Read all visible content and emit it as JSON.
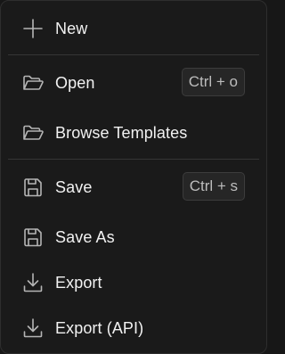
{
  "menu": {
    "items": [
      {
        "label": "New",
        "icon": "plus-icon"
      },
      {
        "label": "Open",
        "icon": "folder-open-icon",
        "shortcut": "Ctrl + o"
      },
      {
        "label": "Browse Templates",
        "icon": "folder-open-icon"
      },
      {
        "label": "Save",
        "icon": "save-icon",
        "shortcut": "Ctrl + s"
      },
      {
        "label": "Save As",
        "icon": "save-icon"
      },
      {
        "label": "Export",
        "icon": "download-icon"
      },
      {
        "label": "Export (API)",
        "icon": "download-icon"
      }
    ]
  },
  "colors": {
    "background": "#1a1a1a",
    "text": "#f2f2f2",
    "icon": "#b5b5b5",
    "shortcut_text": "#bcbcbc",
    "shortcut_border": "#3c3c3c",
    "divider": "#363636"
  }
}
